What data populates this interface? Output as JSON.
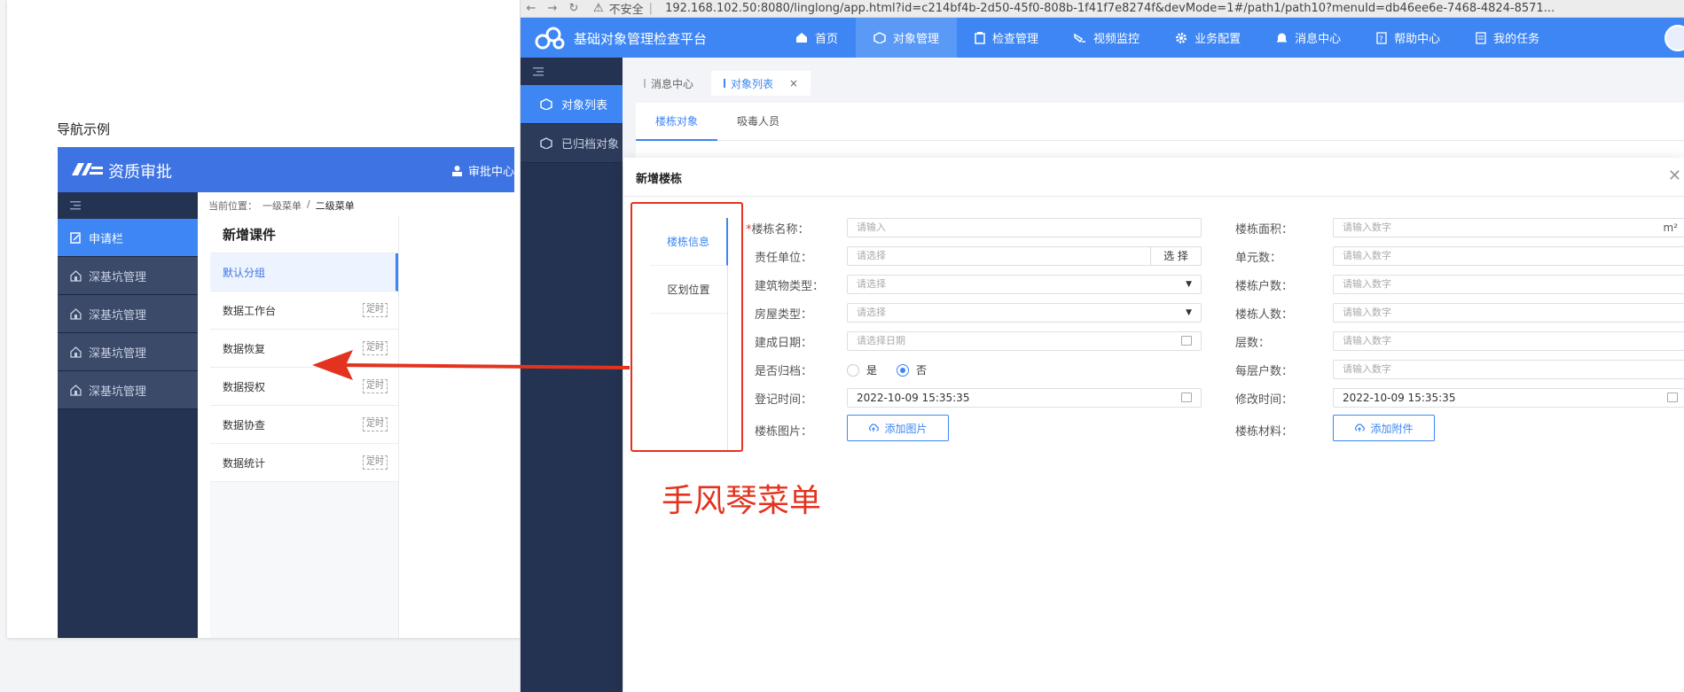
{
  "left_panel": {
    "section_label": "导航示例",
    "app_title": "资质审批",
    "user_label": "审批中心",
    "sidebar_items": [
      {
        "label": "申请栏",
        "active": true,
        "icon": "edit-icon"
      },
      {
        "label": "深基坑管理",
        "active": false,
        "icon": "building-icon"
      },
      {
        "label": "深基坑管理",
        "active": false,
        "icon": "building-icon"
      },
      {
        "label": "深基坑管理",
        "active": false,
        "icon": "building-icon"
      },
      {
        "label": "深基坑管理",
        "active": false,
        "icon": "building-icon"
      }
    ],
    "breadcrumb": {
      "prefix": "当前位置：",
      "level1": "一级菜单",
      "separator": "/",
      "level2": "二级菜单"
    },
    "submenu_title": "新增课件",
    "submenu_items": [
      {
        "label": "默认分组",
        "tag": "",
        "active": true
      },
      {
        "label": "数据工作台",
        "tag": "定时",
        "active": false
      },
      {
        "label": "数据恢复",
        "tag": "定时",
        "active": false
      },
      {
        "label": "数据授权",
        "tag": "定时",
        "active": false
      },
      {
        "label": "数据协查",
        "tag": "定时",
        "active": false
      },
      {
        "label": "数据统计",
        "tag": "定时",
        "active": false
      }
    ]
  },
  "browser": {
    "security_label": "不安全",
    "url": "192.168.102.50:8080/linglong/app.html?id=c214bf4b-2d50-45f0-808b-1f41f7e8274f&devMode=1#/path1/path10?menuId=db46ee6e-7468-4824-8571..."
  },
  "app": {
    "title": "基础对象管理检查平台",
    "top_nav": [
      {
        "label": "首页",
        "icon": "home-icon",
        "active": false
      },
      {
        "label": "对象管理",
        "icon": "cube-icon",
        "active": true
      },
      {
        "label": "检查管理",
        "icon": "clipboard-icon",
        "active": false
      },
      {
        "label": "视频监控",
        "icon": "camera-icon",
        "active": false
      },
      {
        "label": "业务配置",
        "icon": "gear-icon",
        "active": false
      },
      {
        "label": "消息中心",
        "icon": "bell-icon",
        "active": false
      },
      {
        "label": "帮助中心",
        "icon": "help-icon",
        "active": false
      },
      {
        "label": "我的任务",
        "icon": "task-icon",
        "active": false
      }
    ],
    "sidebar": [
      {
        "label": "对象列表",
        "active": true
      },
      {
        "label": "已归档对象",
        "active": false
      }
    ],
    "tabs": [
      {
        "label": "消息中心",
        "active": false,
        "closable": false
      },
      {
        "label": "对象列表",
        "active": true,
        "closable": true
      }
    ],
    "subtabs": [
      {
        "label": "楼栋对象",
        "active": true
      },
      {
        "label": "吸毒人员",
        "active": false
      }
    ]
  },
  "dialog": {
    "title": "新增楼栋",
    "accordion": [
      {
        "label": "楼栋信息",
        "active": true
      },
      {
        "label": "区划位置",
        "active": false
      }
    ],
    "left_fields": [
      {
        "label": "楼栋名称：",
        "required": true,
        "type": "text",
        "placeholder": "请输入",
        "value": ""
      },
      {
        "label": "责任单位：",
        "required": false,
        "type": "select-button",
        "placeholder": "请选择",
        "button": "选 择"
      },
      {
        "label": "建筑物类型：",
        "required": false,
        "type": "dropdown",
        "placeholder": "请选择"
      },
      {
        "label": "房屋类型：",
        "required": false,
        "type": "dropdown",
        "placeholder": "请选择"
      },
      {
        "label": "建成日期：",
        "required": false,
        "type": "date",
        "placeholder": "请选择日期"
      },
      {
        "label": "是否归档：",
        "required": false,
        "type": "radio",
        "options": [
          "是",
          "否"
        ],
        "selected": "否"
      },
      {
        "label": "登记时间：",
        "required": false,
        "type": "date",
        "value": "2022-10-09 15:35:35"
      },
      {
        "label": "楼栋图片：",
        "required": false,
        "type": "upload",
        "button": "添加图片"
      }
    ],
    "right_fields": [
      {
        "label": "楼栋面积：",
        "type": "number",
        "placeholder": "请输入数字",
        "suffix": "m²"
      },
      {
        "label": "单元数：",
        "type": "number",
        "placeholder": "请输入数字"
      },
      {
        "label": "楼栋户数：",
        "type": "number",
        "placeholder": "请输入数字"
      },
      {
        "label": "楼栋人数：",
        "type": "number",
        "placeholder": "请输入数字"
      },
      {
        "label": "层数：",
        "type": "number",
        "placeholder": "请输入数字"
      },
      {
        "label": "每层户数：",
        "type": "number",
        "placeholder": "请输入数字"
      },
      {
        "label": "修改时间：",
        "type": "date",
        "value": "2022-10-09 15:35:35"
      },
      {
        "label": "楼栋材料：",
        "type": "upload",
        "button": "添加附件"
      }
    ]
  },
  "annotation": {
    "note": "手风琴菜单",
    "color": "#e3331e"
  },
  "colors": {
    "primary": "#3d86f4",
    "sidebar": "#253352",
    "accent_red": "#e3331e"
  }
}
